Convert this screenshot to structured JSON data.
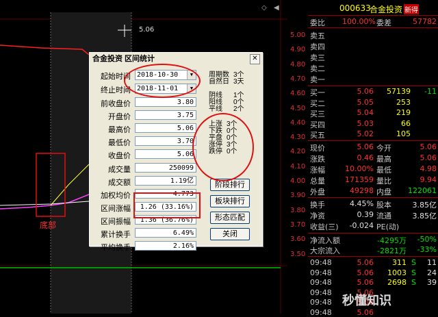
{
  "chart": {
    "cursor_value": "5.06",
    "bottom_label": "底部",
    "price_axis": [
      "5.00",
      "4.90",
      "4.80",
      "4.70",
      "4.60",
      "4.50",
      "4.40",
      "4.30",
      "4.20",
      "4.10",
      "4.00",
      "3.90",
      "3.80",
      "3.70",
      "3.60",
      "3.50"
    ],
    "colors": {
      "price_line": "#ff2020",
      "avg_line": "#ffff40",
      "grid": "#600000",
      "white_line": "#ffffff"
    }
  },
  "dialog": {
    "title": "合金投资 区间统计",
    "start_label": "起始时间",
    "start_value": "2018-10-30",
    "end_label": "终止时间",
    "end_value": "2018-11-01",
    "fields": [
      {
        "label": "前收盘价",
        "value": "3.80"
      },
      {
        "label": "开盘价",
        "value": "3.75"
      },
      {
        "label": "最高价",
        "value": "5.06"
      },
      {
        "label": "最低价",
        "value": "3.70"
      },
      {
        "label": "收盘价",
        "value": "5.06"
      },
      {
        "label": "成交量",
        "value": "250099"
      },
      {
        "label": "成交额",
        "value": "1.19亿"
      },
      {
        "label": "加权均价",
        "value": "4.773"
      },
      {
        "label": "区间涨幅",
        "value": "1.26 (33.16%)"
      },
      {
        "label": "区间振幅",
        "value": "1.36 (36.76%)"
      },
      {
        "label": "累计换手",
        "value": "6.49%"
      },
      {
        "label": "平均换手",
        "value": "2.16%"
      }
    ],
    "period_counts": [
      {
        "label": "周期数",
        "value": "3个"
      },
      {
        "label": "自然日",
        "value": "3天"
      },
      {
        "label": "阴线",
        "value": "1个"
      },
      {
        "label": "阳线",
        "value": "0个"
      },
      {
        "label": "平线",
        "value": "2个"
      }
    ],
    "move_counts": [
      {
        "label": "上涨",
        "value": "3个"
      },
      {
        "label": "下跌",
        "value": "0个"
      },
      {
        "label": "平盘",
        "value": "0个"
      },
      {
        "label": "涨停",
        "value": "3个"
      },
      {
        "label": "跌停",
        "value": "0个"
      }
    ],
    "buttons": [
      "阶段排行",
      "板块排行",
      "形态匹配",
      "关闭"
    ]
  },
  "panel": {
    "code": "000633",
    "name": "合金投资",
    "tag": "新得",
    "weibi_label": "委比",
    "weibi_value": "100.00%",
    "weicha_label": "委差",
    "weicha_value": "57782",
    "sell_rows": [
      "卖五",
      "卖四",
      "卖三",
      "卖二",
      "卖一"
    ],
    "buy_rows": [
      {
        "label": "买一",
        "price": "5.06",
        "vol": "57139",
        "chg": "-11"
      },
      {
        "label": "买二",
        "price": "5.05",
        "vol": "253",
        "chg": ""
      },
      {
        "label": "买三",
        "price": "5.04",
        "vol": "219",
        "chg": ""
      },
      {
        "label": "买四",
        "price": "5.03",
        "vol": "66",
        "chg": ""
      },
      {
        "label": "买五",
        "price": "5.02",
        "vol": "105",
        "chg": ""
      }
    ],
    "quote_rows": [
      {
        "l1": "现价",
        "v1": "5.06",
        "l2": "今开",
        "v2": "5.06"
      },
      {
        "l1": "涨跌",
        "v1": "0.46",
        "l2": "最高",
        "v2": "5.06"
      },
      {
        "l1": "涨幅",
        "v1": "10.00%",
        "l2": "最低",
        "v2": "4.98"
      },
      {
        "l1": "总量",
        "v1": "171359",
        "l2": "量比",
        "v2": "9.94"
      },
      {
        "l1": "外盘",
        "v1": "49298",
        "l2": "内盘",
        "v2": "122061"
      }
    ],
    "stat_rows": [
      {
        "l1": "换手",
        "v1": "4.45%",
        "l2": "股本",
        "v2": "3.85亿"
      },
      {
        "l1": "净资",
        "v1": "0.39",
        "l2": "流通",
        "v2": "3.85亿"
      },
      {
        "l1": "收益(三)",
        "v1": "-0.024",
        "l2": "PE(动)",
        "v2": ""
      }
    ],
    "flow_rows": [
      {
        "label": "净流入额",
        "value": "-4295万",
        "pct": "-50%"
      },
      {
        "label": "大宗流入",
        "value": "-2821万",
        "pct": "-33%"
      }
    ],
    "ticks": [
      {
        "time": "09:48",
        "price": "5.06",
        "vol": "311",
        "flag": "S",
        "num": "11"
      },
      {
        "time": "09:48",
        "price": "5.06",
        "vol": "1003",
        "flag": "S",
        "num": "24"
      },
      {
        "time": "09:48",
        "price": "5.06",
        "vol": "2698",
        "flag": "S",
        "num": "39"
      },
      {
        "time": "09:48",
        "price": "5.06",
        "vol": "",
        "flag": "",
        "num": ""
      },
      {
        "time": "09:48",
        "price": "5.06",
        "vol": "",
        "flag": "",
        "num": ""
      },
      {
        "time": "09:48",
        "price": "5.06",
        "vol": "",
        "flag": "",
        "num": ""
      }
    ],
    "watermark": "秒懂知识"
  }
}
